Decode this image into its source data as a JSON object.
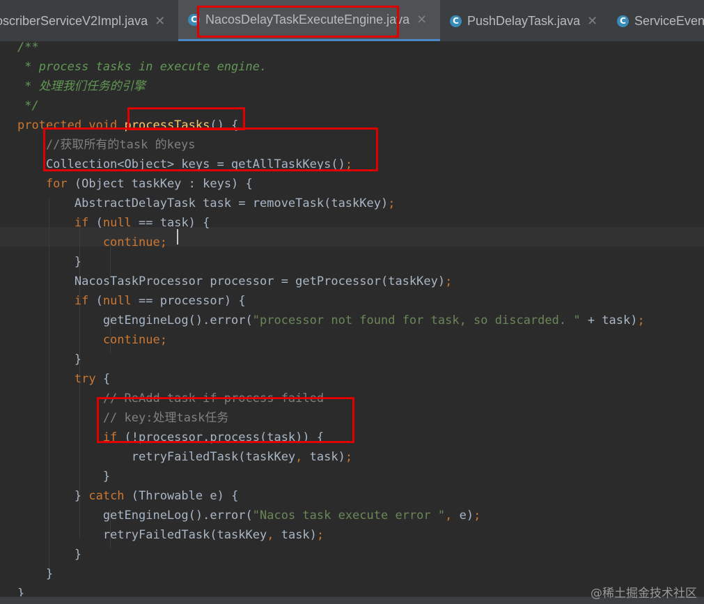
{
  "tabs": [
    {
      "label": "oscriberServiceV2Impl.java",
      "active": false,
      "icon": null,
      "close": "✕"
    },
    {
      "label": "NacosDelayTaskExecuteEngine.java",
      "active": true,
      "icon": "C",
      "close": "✕"
    },
    {
      "label": "PushDelayTask.java",
      "active": false,
      "icon": "C",
      "close": "✕"
    },
    {
      "label": "ServiceEven",
      "active": false,
      "icon": "C",
      "close": ""
    }
  ],
  "code": [
    [
      {
        "t": "doc",
        "v": "/**"
      }
    ],
    [
      {
        "t": "doc",
        "v": " * process tasks in execute engine."
      }
    ],
    [
      {
        "t": "doc",
        "v": " * 处理我们任务的引擎"
      }
    ],
    [
      {
        "t": "doc",
        "v": " */"
      }
    ],
    [
      {
        "t": "kw",
        "v": "protected void "
      },
      {
        "t": "fn",
        "v": "processTasks"
      },
      {
        "t": "p",
        "v": "() {"
      }
    ],
    [
      {
        "t": "cmt",
        "v": "    //获取所有的task 的keys"
      }
    ],
    [
      {
        "t": "p",
        "v": "    Collection<Object> keys = getAllTaskKeys()"
      },
      {
        "t": "kw",
        "v": ";"
      }
    ],
    [
      {
        "t": "kw",
        "v": "    for "
      },
      {
        "t": "p",
        "v": "(Object taskKey : keys) {"
      }
    ],
    [
      {
        "t": "p",
        "v": "        AbstractDelayTask task = removeTask(taskKey)"
      },
      {
        "t": "kw",
        "v": ";"
      }
    ],
    [
      {
        "t": "kw",
        "v": "        if "
      },
      {
        "t": "p",
        "v": "("
      },
      {
        "t": "kw",
        "v": "null "
      },
      {
        "t": "p",
        "v": "== task) {"
      }
    ],
    [
      {
        "t": "kw",
        "v": "            continue;"
      }
    ],
    [
      {
        "t": "p",
        "v": "        }"
      }
    ],
    [
      {
        "t": "p",
        "v": "        NacosTaskProcessor processor = getProcessor(taskKey)"
      },
      {
        "t": "kw",
        "v": ";"
      }
    ],
    [
      {
        "t": "kw",
        "v": "        if "
      },
      {
        "t": "p",
        "v": "("
      },
      {
        "t": "kw",
        "v": "null "
      },
      {
        "t": "p",
        "v": "== processor) {"
      }
    ],
    [
      {
        "t": "p",
        "v": "            getEngineLog().error("
      },
      {
        "t": "str",
        "v": "\"processor not found for task, so discarded. \""
      },
      {
        "t": "p",
        "v": " + task)"
      },
      {
        "t": "kw",
        "v": ";"
      }
    ],
    [
      {
        "t": "kw",
        "v": "            continue;"
      }
    ],
    [
      {
        "t": "p",
        "v": "        }"
      }
    ],
    [
      {
        "t": "kw",
        "v": "        try "
      },
      {
        "t": "p",
        "v": "{"
      }
    ],
    [
      {
        "t": "cmt",
        "v": "            // ReAdd task if process failed"
      }
    ],
    [
      {
        "t": "cmt",
        "v": "            // key:处理task任务"
      }
    ],
    [
      {
        "t": "kw",
        "v": "            if "
      },
      {
        "t": "p",
        "v": "(!processor.process(task)) {"
      }
    ],
    [
      {
        "t": "p",
        "v": "                retryFailedTask(taskKey"
      },
      {
        "t": "kw",
        "v": ", "
      },
      {
        "t": "p",
        "v": "task)"
      },
      {
        "t": "kw",
        "v": ";"
      }
    ],
    [
      {
        "t": "p",
        "v": "            }"
      }
    ],
    [
      {
        "t": "p",
        "v": "        } "
      },
      {
        "t": "kw",
        "v": "catch "
      },
      {
        "t": "p",
        "v": "(Throwable e) {"
      }
    ],
    [
      {
        "t": "p",
        "v": "            getEngineLog().error("
      },
      {
        "t": "str",
        "v": "\"Nacos task execute error \""
      },
      {
        "t": "kw",
        "v": ", "
      },
      {
        "t": "p",
        "v": "e)"
      },
      {
        "t": "kw",
        "v": ";"
      }
    ],
    [
      {
        "t": "p",
        "v": "            retryFailedTask(taskKey"
      },
      {
        "t": "kw",
        "v": ", "
      },
      {
        "t": "p",
        "v": "task)"
      },
      {
        "t": "kw",
        "v": ";"
      }
    ],
    [
      {
        "t": "p",
        "v": "        }"
      }
    ],
    [
      {
        "t": "p",
        "v": "    }"
      }
    ],
    [
      {
        "t": "p",
        "v": "}"
      }
    ]
  ],
  "watermark": "@稀土掘金技术社区"
}
